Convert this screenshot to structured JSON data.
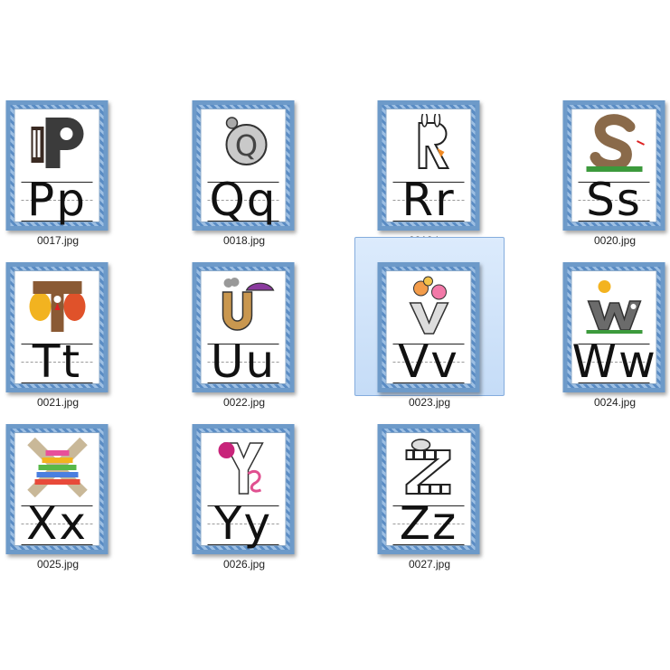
{
  "files": [
    {
      "name": "0017.jpg",
      "letters": "Pp",
      "icon": "piano-letter-p-icon",
      "selected": false
    },
    {
      "name": "0018.jpg",
      "letters": "Qq",
      "icon": "quail-letter-q-icon",
      "selected": false
    },
    {
      "name": "0019.jpg",
      "letters": "Rr",
      "icon": "rabbit-letter-r-icon",
      "selected": false
    },
    {
      "name": "0020.jpg",
      "letters": "Ss",
      "icon": "snake-letter-s-icon",
      "selected": false
    },
    {
      "name": "0021.jpg",
      "letters": "Tt",
      "icon": "turkey-letter-t-icon",
      "selected": false
    },
    {
      "name": "0022.jpg",
      "letters": "Uu",
      "icon": "umbrella-letter-u-icon",
      "selected": false
    },
    {
      "name": "0023.jpg",
      "letters": "Vv",
      "icon": "vase-letter-v-icon",
      "selected": true
    },
    {
      "name": "0024.jpg",
      "letters": "Ww",
      "icon": "worm-letter-w-icon",
      "selected": false
    },
    {
      "name": "0025.jpg",
      "letters": "Xx",
      "icon": "xylophone-letter-x-icon",
      "selected": false
    },
    {
      "name": "0026.jpg",
      "letters": "Yy",
      "icon": "yarn-letter-y-icon",
      "selected": false
    },
    {
      "name": "0027.jpg",
      "letters": "Zz",
      "icon": "zebra-letter-z-icon",
      "selected": false
    }
  ],
  "colors": {
    "selection_fill": "#cfe3f8",
    "selection_border": "#84acdd",
    "card_border": "#6d9ac9"
  }
}
